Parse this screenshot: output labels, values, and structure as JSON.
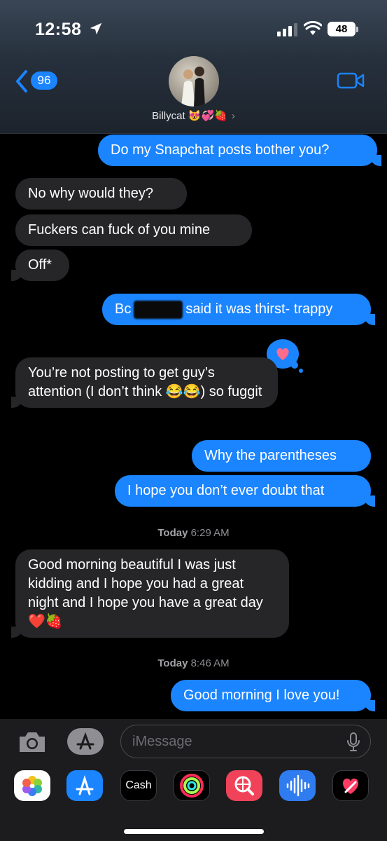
{
  "status_bar": {
    "time": "12:58",
    "battery": "48"
  },
  "header": {
    "back_count": "96",
    "contact_name": "Billycat 😻💞🍓"
  },
  "messages": [
    {
      "dir": "out",
      "text": "Do my Snapchat posts bother you?"
    },
    {
      "dir": "in",
      "text": "No why would they?"
    },
    {
      "dir": "in",
      "text": "Fuckers can fuck of you mine"
    },
    {
      "dir": "in",
      "text": "Off*"
    },
    {
      "dir": "out",
      "text_prefix": "Bc",
      "text_suffix": "said it was thirst- trappy"
    },
    {
      "dir": "in",
      "text": "You’re not posting to get guy’s attention (I don’t think 😂😂) so fuggit"
    },
    {
      "dir": "out",
      "text": "Why the parentheses"
    },
    {
      "dir": "out",
      "text": "I hope you don’t ever doubt that"
    },
    {
      "dir": "in",
      "text": "Good morning beautiful I was just kidding and I hope you had a great night and I hope you have a great day❤️🍓"
    },
    {
      "dir": "out",
      "text": "Good morning I love you!"
    }
  ],
  "timestamps": [
    {
      "day": "Today",
      "time": "6:29 AM"
    },
    {
      "day": "Today",
      "time": "8:46 AM"
    }
  ],
  "compose": {
    "placeholder": "iMessage"
  },
  "app_drawer": {
    "cash_label": "Cash"
  },
  "colors": {
    "outgoing": "#1b84ff",
    "incoming": "#262628",
    "background": "#000000"
  }
}
